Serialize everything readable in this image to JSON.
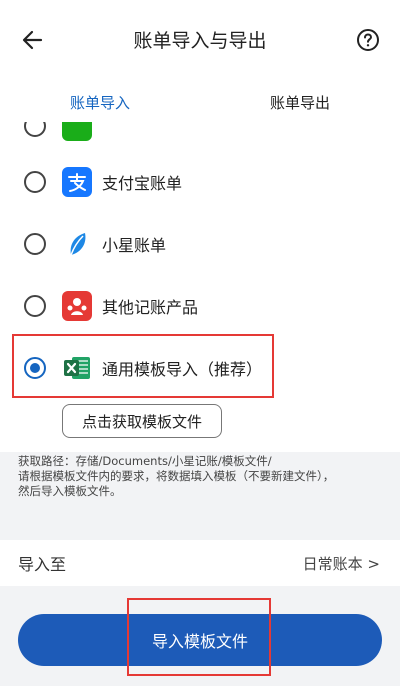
{
  "header": {
    "title": "账单导入与导出",
    "back_icon": "arrow-left-icon",
    "help_icon": "question-circle-icon"
  },
  "tabs": [
    {
      "label": "账单导入",
      "active": true
    },
    {
      "label": "账单导出",
      "active": false
    }
  ],
  "list": {
    "items": [
      {
        "label": "支付宝账单",
        "icon": "alipay-icon",
        "color": "#1677ff",
        "selected": false
      },
      {
        "label": "小星账单",
        "icon": "leaf-icon",
        "color": "#1e88e5",
        "selected": false
      },
      {
        "label": "其他记账产品",
        "icon": "people-icon",
        "color": "#e53935",
        "selected": false
      },
      {
        "label": "通用模板导入（推荐）",
        "icon": "excel-icon",
        "color": "#1e7145",
        "selected": true
      }
    ],
    "template_button": "点击获取模板文件"
  },
  "info": {
    "line1": "获取路径：存储/Documents/小星记账/模板文件/",
    "line2": "请根据模板文件内的要求，将数据填入模板（不要新建文件），",
    "line3": "然后导入模板文件。"
  },
  "import_to": {
    "label": "导入至",
    "value": "日常账本 >"
  },
  "primary_button": "导入模板文件",
  "colors": {
    "accent": "#1565c0",
    "button": "#1d5bb8",
    "highlight": "#e53935"
  }
}
